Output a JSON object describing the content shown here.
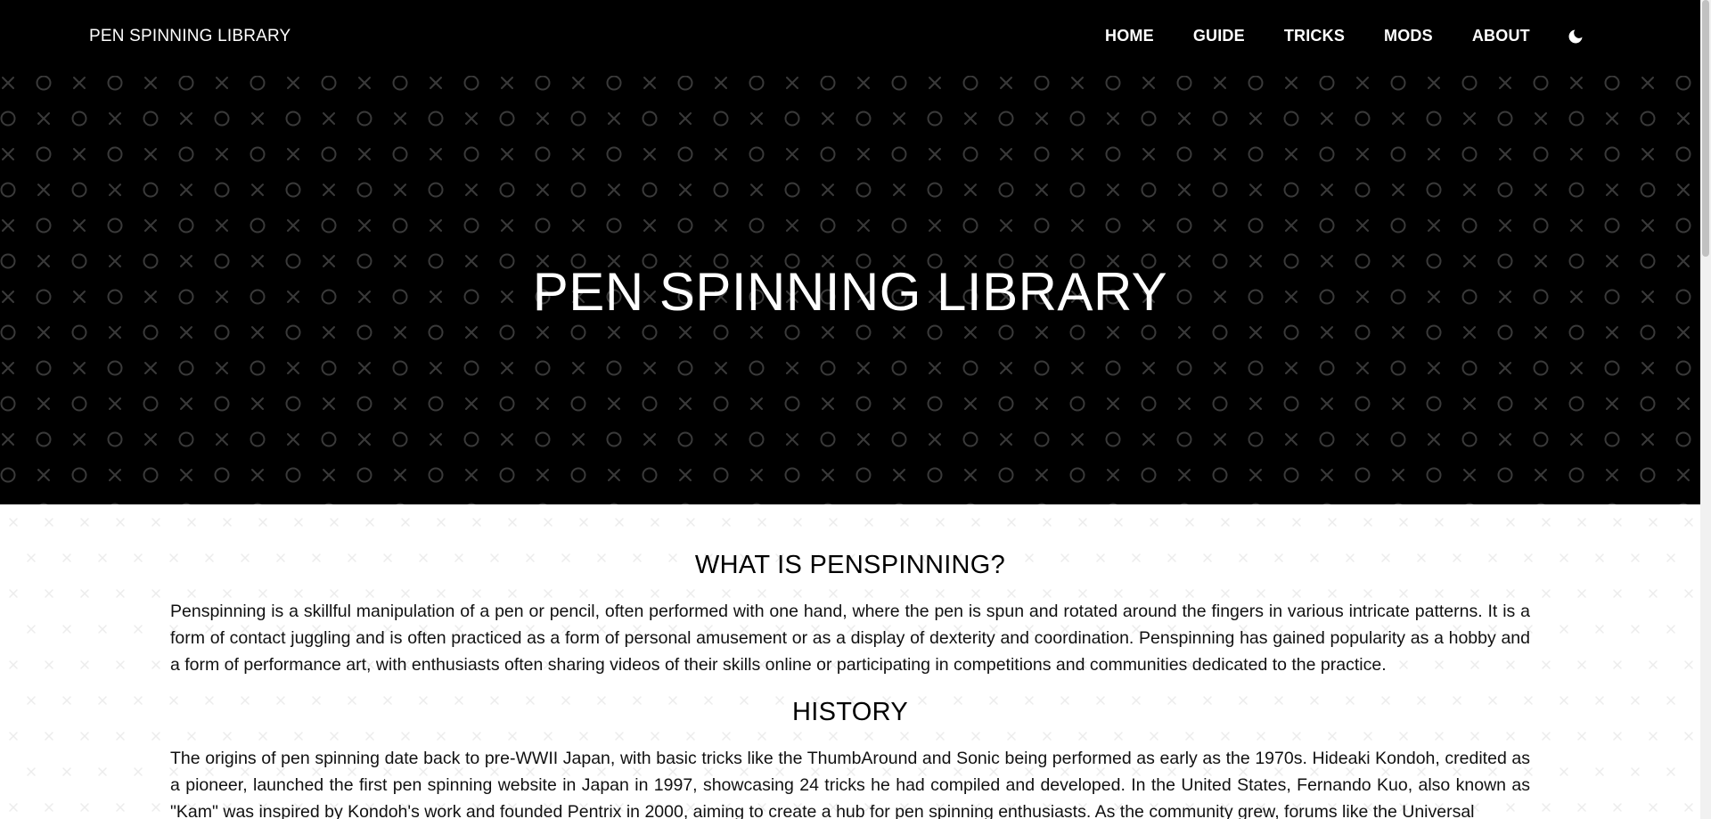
{
  "navbar": {
    "brand": "PEN SPINNING LIBRARY",
    "links": [
      "HOME",
      "GUIDE",
      "TRICKS",
      "MODS",
      "ABOUT"
    ],
    "theme_toggle_icon": "moon-icon"
  },
  "hero": {
    "title": "PEN SPINNING LIBRARY",
    "pattern_icons": [
      "x-icon",
      "circle-icon"
    ]
  },
  "sections": [
    {
      "heading": "WHAT IS PENSPINNING?",
      "text": "Penspinning is a skillful manipulation of a pen or pencil, often performed with one hand, where the pen is spun and rotated around the fingers in various intricate patterns. It is a form of contact juggling and is often practiced as a form of personal amusement or as a display of dexterity and coordination. Penspinning has gained popularity as a hobby and a form of performance art, with enthusiasts often sharing videos of their skills online or participating in competitions and communities dedicated to the practice."
    },
    {
      "heading": "HISTORY",
      "text": "The origins of pen spinning date back to pre-WWII Japan, with basic tricks like the ThumbAround and Sonic being performed as early as the 1970s. Hideaki Kondoh, credited as a pioneer, launched the first pen spinning website in Japan in 1997, showcasing 24 tricks he had compiled and developed. In the United States, Fernando Kuo, also known as \"Kam\" was inspired by Kondoh's work and founded Pentrix in 2000, aiming to create a hub for pen spinning enthusiasts. As the community grew, forums like the Universal"
    }
  ],
  "colors": {
    "header_bg": "#000000",
    "header_text": "#ffffff",
    "hero_pattern": "#3a3a3a",
    "content_pattern": "#ececec",
    "body_text": "#111111"
  }
}
